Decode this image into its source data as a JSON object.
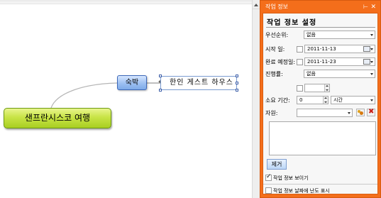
{
  "mindmap": {
    "root": "샌프란시스코 여행",
    "child": "숙박",
    "grandchild": "한인 게스트 하우스"
  },
  "pane": {
    "title": "작업 정보",
    "pin_glyph": "⊢",
    "close_glyph": "✕",
    "heading": "작업 정보 설정",
    "priority": {
      "label": "우선순위:",
      "value": "없음"
    },
    "start_date": {
      "label": "시작 일:",
      "value": "2011-11-13"
    },
    "due_date": {
      "label": "완료 예정일:",
      "value": "2011-11-23"
    },
    "progress": {
      "label": "진행률:",
      "value": "없음"
    },
    "duration": {
      "label": "소요 기간:",
      "value": "0",
      "unit": "시간"
    },
    "resource": {
      "label": "자원:"
    },
    "remove_button": "제거",
    "show_task_info": {
      "label": "작업 정보 보이기",
      "checked": true
    },
    "show_difficulty": {
      "label": "작업 정보 날짜에 난도 표시",
      "checked": false
    }
  },
  "colors": {
    "pane_accent": "#f46e1b",
    "root_node": "#b8d92e",
    "child_node": "#9dc0f2"
  }
}
